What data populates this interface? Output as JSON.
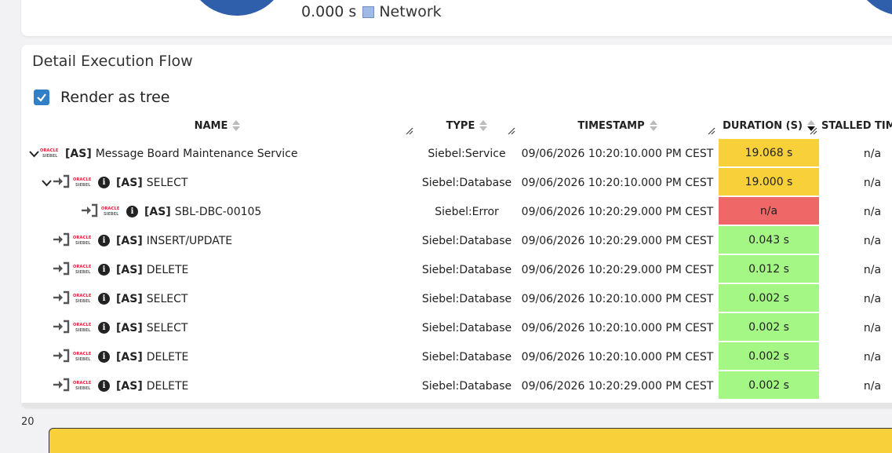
{
  "summary": {
    "network_value": "0.000 s",
    "network_label": "Network",
    "network_color": "#9fbbe5",
    "donut_color": "#2f5faa"
  },
  "flow": {
    "title": "Detail Execution Flow",
    "render_as_tree": {
      "label": "Render as tree",
      "checked": true
    }
  },
  "columns": {
    "name": "NAME",
    "type": "TYPE",
    "timestamp": "TIMESTAMP",
    "duration": "DURATION (S)",
    "stalled": "STALLED TIM"
  },
  "rows": [
    {
      "indent": 0,
      "expander": true,
      "enter_icon": false,
      "info_icon": false,
      "tag": "[AS]",
      "name": "Message Board Maintenance Service",
      "type": "Siebel:Service",
      "timestamp": "09/06/2026 10:20:10.000 PM CEST",
      "duration": "19.068 s",
      "status": "yellow",
      "stalled": "n/a"
    },
    {
      "indent": 1,
      "expander": true,
      "enter_icon": true,
      "info_icon": true,
      "tag": "[AS]",
      "name": "SELECT",
      "type": "Siebel:Database",
      "timestamp": "09/06/2026 10:20:10.000 PM CEST",
      "duration": "19.000 s",
      "status": "yellow",
      "stalled": "n/a"
    },
    {
      "indent": 2,
      "expander": false,
      "enter_icon": true,
      "info_icon": true,
      "tag": "[AS]",
      "name": "SBL-DBC-00105",
      "type": "Siebel:Error",
      "timestamp": "09/06/2026 10:20:29.000 PM CEST",
      "duration": "n/a",
      "status": "red",
      "stalled": "n/a"
    },
    {
      "indent": 1,
      "expander": false,
      "enter_icon": true,
      "info_icon": true,
      "tag": "[AS]",
      "name": "INSERT/UPDATE",
      "type": "Siebel:Database",
      "timestamp": "09/06/2026 10:20:29.000 PM CEST",
      "duration": "0.043 s",
      "status": "green",
      "stalled": "n/a"
    },
    {
      "indent": 1,
      "expander": false,
      "enter_icon": true,
      "info_icon": true,
      "tag": "[AS]",
      "name": "DELETE",
      "type": "Siebel:Database",
      "timestamp": "09/06/2026 10:20:29.000 PM CEST",
      "duration": "0.012 s",
      "status": "green",
      "stalled": "n/a"
    },
    {
      "indent": 1,
      "expander": false,
      "enter_icon": true,
      "info_icon": true,
      "tag": "[AS]",
      "name": "SELECT",
      "type": "Siebel:Database",
      "timestamp": "09/06/2026 10:20:10.000 PM CEST",
      "duration": "0.002 s",
      "status": "green",
      "stalled": "n/a"
    },
    {
      "indent": 1,
      "expander": false,
      "enter_icon": true,
      "info_icon": true,
      "tag": "[AS]",
      "name": "SELECT",
      "type": "Siebel:Database",
      "timestamp": "09/06/2026 10:20:10.000 PM CEST",
      "duration": "0.002 s",
      "status": "green",
      "stalled": "n/a"
    },
    {
      "indent": 1,
      "expander": false,
      "enter_icon": true,
      "info_icon": true,
      "tag": "[AS]",
      "name": "DELETE",
      "type": "Siebel:Database",
      "timestamp": "09/06/2026 10:20:10.000 PM CEST",
      "duration": "0.002 s",
      "status": "green",
      "stalled": "n/a"
    },
    {
      "indent": 1,
      "expander": false,
      "enter_icon": true,
      "info_icon": true,
      "tag": "[AS]",
      "name": "DELETE",
      "type": "Siebel:Database",
      "timestamp": "09/06/2026 10:20:29.000 PM CEST",
      "duration": "0.002 s",
      "status": "green",
      "stalled": "n/a"
    }
  ],
  "logo": {
    "line1": "ORACLE",
    "line2": "SIEBEL"
  },
  "timeline": {
    "y_tick": "20",
    "bar_color": "#f8d03a"
  }
}
